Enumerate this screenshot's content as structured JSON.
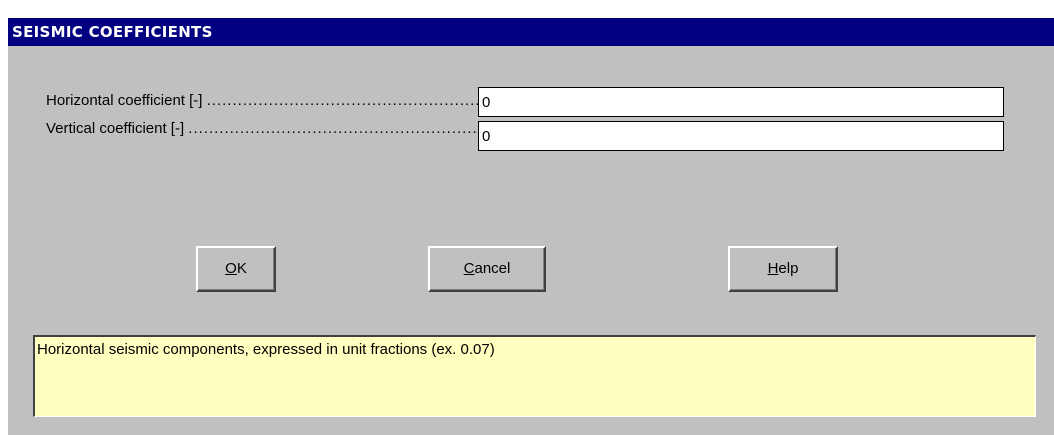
{
  "window": {
    "title": "SEISMIC COEFFICIENTS"
  },
  "fields": [
    {
      "label": "Horizontal coefficient [-]",
      "value": "0"
    },
    {
      "label": "Vertical coefficient [-]",
      "value": "0"
    }
  ],
  "buttons": {
    "ok": {
      "mnemonic": "O",
      "rest": "K"
    },
    "cancel": {
      "mnemonic": "C",
      "rest": "ancel"
    },
    "help": {
      "mnemonic": "H",
      "rest": "elp"
    }
  },
  "help_text": "Horizontal seismic components, expressed in unit fractions (ex. 0.07)",
  "colors": {
    "title_bar": "#000080",
    "dialog_bg": "#c0c0c0",
    "help_bg": "#ffffc0"
  }
}
